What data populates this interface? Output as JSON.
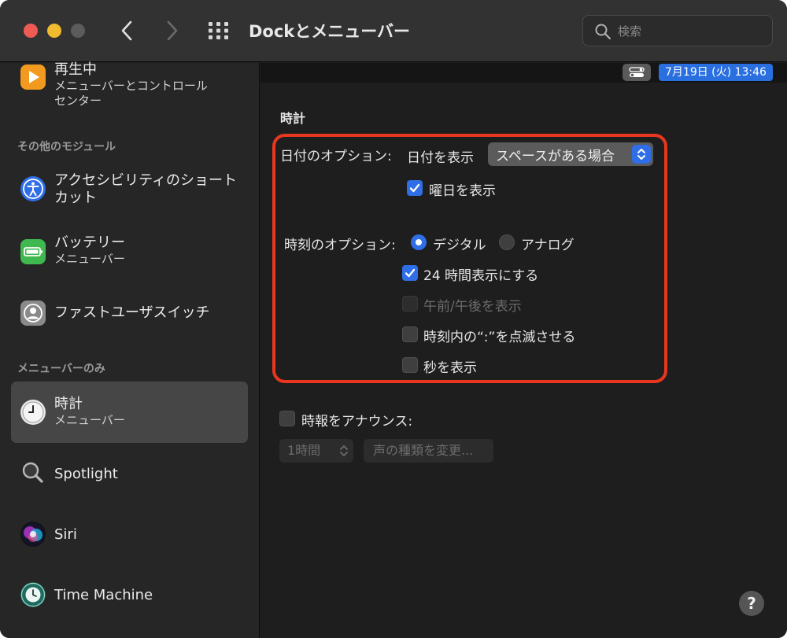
{
  "window": {
    "title": "Dockとメニューバー",
    "search_placeholder": "検索"
  },
  "sidebar": {
    "now_playing": {
      "label": "再生中",
      "sub": "メニューバーとコントロールセンター",
      "sub_line1": "メニューバーとコントロール",
      "sub_line2": "センター",
      "icon": "play-icon"
    },
    "header_other": "その他のモジュール",
    "accessibility": {
      "label_line1": "アクセシビリティのショート",
      "label_line2": "カット",
      "icon": "accessibility-icon"
    },
    "battery": {
      "label": "バッテリー",
      "sub": "メニューバー",
      "icon": "battery-icon"
    },
    "fast_user": {
      "label": "ファストユーザスイッチ",
      "icon": "user-icon"
    },
    "header_menubar": "メニューバーのみ",
    "clock": {
      "label": "時計",
      "sub": "メニューバー",
      "icon": "clock-icon",
      "selected": true
    },
    "spotlight": {
      "label": "Spotlight",
      "icon": "spotlight-icon"
    },
    "siri": {
      "label": "Siri",
      "icon": "siri-icon"
    },
    "time_machine": {
      "label": "Time Machine",
      "icon": "time-machine-icon"
    }
  },
  "preview": {
    "clock_text": "7月19日 (火)  13:46"
  },
  "clock_settings": {
    "section_title": "時計",
    "date_options_label": "日付のオプション:",
    "show_date_label": "日付を表示",
    "show_date_value": "スペースがある場合",
    "show_weekday_label": "曜日を表示",
    "show_weekday_checked": true,
    "time_options_label": "時刻のオプション:",
    "digital_label": "デジタル",
    "analog_label": "アナログ",
    "style_selected": "デジタル",
    "use_24h_label": "24 時間表示にする",
    "use_24h_checked": true,
    "show_ampm_label": "午前/午後を表示",
    "show_ampm_enabled": false,
    "flash_separators_label": "時刻内の“:”を点滅させる",
    "flash_separators_checked": false,
    "show_seconds_label": "秒を表示",
    "show_seconds_checked": false,
    "announce_label": "時報をアナウンス:",
    "announce_checked": false,
    "interval_value": "1時間",
    "voice_button_label": "声の種類を変更..."
  },
  "help_label": "?",
  "colors": {
    "accent": "#2f6ee6",
    "highlight_border": "#e8361f",
    "window_bg": "#1e1e1e",
    "sidebar_bg": "#262626"
  }
}
